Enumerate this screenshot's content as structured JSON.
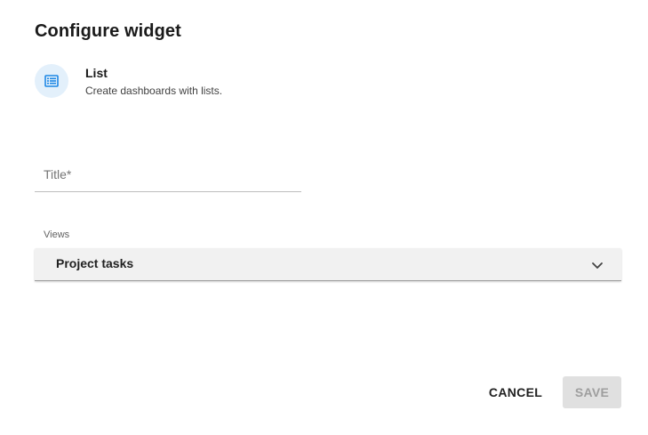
{
  "dialog": {
    "title": "Configure widget"
  },
  "widget_type": {
    "icon": "list-icon",
    "name": "List",
    "description": "Create dashboards with lists.",
    "accent_color": "#1e88e5",
    "icon_background": "#e3f0fb"
  },
  "title_field": {
    "placeholder": "Title*",
    "value": ""
  },
  "views_field": {
    "label": "Views",
    "selected": "Project tasks",
    "icon": "chevron-down-icon"
  },
  "actions": {
    "cancel_label": "CANCEL",
    "save_label": "SAVE",
    "save_enabled": false
  }
}
